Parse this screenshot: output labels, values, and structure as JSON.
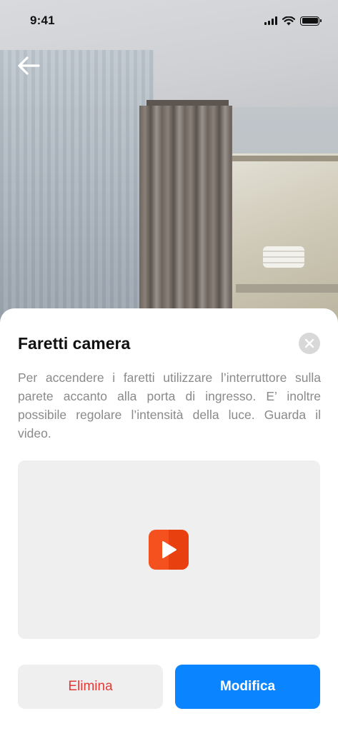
{
  "status_bar": {
    "time": "9:41"
  },
  "icons": {
    "back": "arrow-left-icon",
    "close": "close-icon",
    "play": "play-icon",
    "signal": "cellular-signal-icon",
    "wifi": "wifi-icon",
    "battery": "battery-icon"
  },
  "sheet": {
    "title": "Faretti camera",
    "description": "Per accendere i faretti utilizzare l’interruttore sulla parete accanto alla porta di ingresso. E’ inoltre possibile regolare l’intensità della luce. Guarda il video.",
    "delete_label": "Elimina",
    "edit_label": "Modifica"
  },
  "colors": {
    "accent": "#0A84FF",
    "danger": "#E53935",
    "play": "#F4511E"
  }
}
